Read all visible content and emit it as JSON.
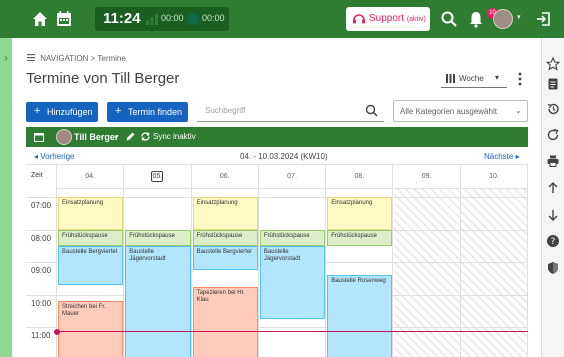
{
  "topbar": {
    "clock": "11:24",
    "counter_a": "00:00",
    "counter_b": "00:00",
    "support_label": "Support",
    "support_sub": "(aktiv)",
    "notifications_count": "10"
  },
  "breadcrumb": {
    "root": "NAVIGATION",
    "separator": ">",
    "current": "Termine"
  },
  "page": {
    "title": "Termine von Till Berger"
  },
  "view": {
    "selected": "Woche"
  },
  "toolbar": {
    "add_label": "Hinzufügen",
    "find_label": "Termin finden",
    "search_placeholder": "Suchbegriff",
    "category_selected": "Alle Kategorien ausgewählt"
  },
  "calendar": {
    "user": "Till Berger",
    "sync_status": "Sync inaktiv",
    "prev_label": "Vorherige",
    "next_label": "Nächste",
    "range": "04. - 10.03.2024 (KW10)",
    "time_header": "Zeit",
    "days": [
      {
        "label": "04.",
        "today": false,
        "weekend": false
      },
      {
        "label": "05.",
        "today": true,
        "weekend": false
      },
      {
        "label": "06.",
        "today": false,
        "weekend": false
      },
      {
        "label": "07.",
        "today": false,
        "weekend": false
      },
      {
        "label": "08.",
        "today": false,
        "weekend": false
      },
      {
        "label": "09.",
        "today": false,
        "weekend": true
      },
      {
        "label": "10.",
        "today": false,
        "weekend": true
      }
    ],
    "hours": [
      "07:00",
      "08:00",
      "09:00",
      "10:00",
      "11:00"
    ],
    "events": [
      {
        "day": 0,
        "start": 7.0,
        "end": 8.0,
        "title": "Einsatzplanung",
        "color": "yellow"
      },
      {
        "day": 2,
        "start": 7.0,
        "end": 8.0,
        "title": "Einsatzplanung",
        "color": "yellow"
      },
      {
        "day": 4,
        "start": 7.0,
        "end": 8.0,
        "title": "Einsatzplanung",
        "color": "yellow"
      },
      {
        "day": 0,
        "start": 8.0,
        "end": 8.5,
        "title": "Frühstückspause",
        "color": "green"
      },
      {
        "day": 1,
        "start": 8.0,
        "end": 8.5,
        "title": "Frühstückspause",
        "color": "green"
      },
      {
        "day": 2,
        "start": 8.0,
        "end": 8.5,
        "title": "Frühstückspause",
        "color": "green"
      },
      {
        "day": 3,
        "start": 8.0,
        "end": 8.5,
        "title": "Frühstückspause",
        "color": "green"
      },
      {
        "day": 4,
        "start": 8.0,
        "end": 8.5,
        "title": "Frühstückspause",
        "color": "green"
      },
      {
        "day": 0,
        "start": 8.5,
        "end": 9.7,
        "title": "Baustelle Bergviertel",
        "color": "blue"
      },
      {
        "day": 1,
        "start": 8.5,
        "end": 12.0,
        "title": "Baustelle Jägervorstadt",
        "color": "blue"
      },
      {
        "day": 2,
        "start": 8.5,
        "end": 9.25,
        "title": "Baustelle Bergviertel",
        "color": "blue"
      },
      {
        "day": 3,
        "start": 8.5,
        "end": 10.75,
        "title": "Baustelle Jägervorstadt",
        "color": "blue"
      },
      {
        "day": 4,
        "start": 9.4,
        "end": 12.0,
        "title": "Baustelle Rosenweg",
        "color": "blue"
      },
      {
        "day": 2,
        "start": 9.75,
        "end": 12.0,
        "title": "Tapezieren bei Hr. Klau",
        "color": "red"
      },
      {
        "day": 0,
        "start": 10.2,
        "end": 12.0,
        "title": "Streichen bei Fr. Mauer",
        "color": "red"
      }
    ],
    "now": 11.12
  },
  "colors": {
    "brand_green": "#2e7d32",
    "primary_blue": "#1565c0",
    "support_pink": "#e91e63",
    "now_line": "#c2185b"
  },
  "icons": {
    "topbar": [
      "home-icon",
      "calendar-icon",
      "chart-icon",
      "globe-icon",
      "support-icon",
      "search-icon",
      "bell-icon",
      "logout-icon"
    ],
    "sidebar": [
      "star-icon",
      "document-icon",
      "history-icon",
      "refresh-icon",
      "print-icon",
      "arrow-up-icon",
      "arrow-down-icon",
      "help-icon",
      "shield-icon"
    ]
  }
}
